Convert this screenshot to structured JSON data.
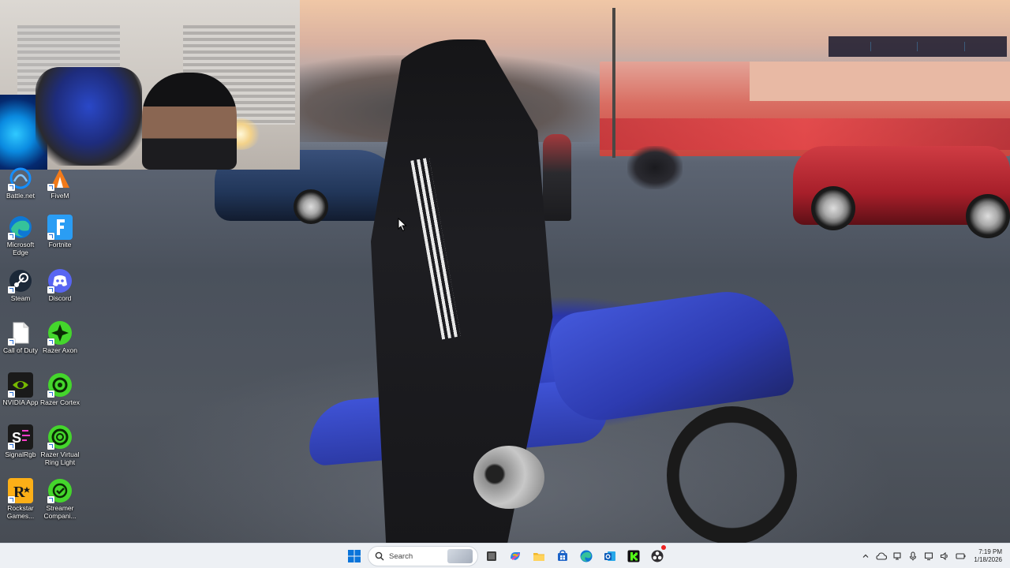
{
  "desktop": {
    "icons": [
      {
        "label": "Battle.net",
        "icon": "battlenet-icon",
        "color": "#148eff"
      },
      {
        "label": "FiveM",
        "icon": "fivem-icon",
        "color": "#f27a1a"
      },
      {
        "label": "Microsoft Edge",
        "icon": "edge-icon",
        "color": "#1fa37a"
      },
      {
        "label": "Fortnite",
        "icon": "fortnite-icon",
        "color": "#2a9df4"
      },
      {
        "label": "Steam",
        "icon": "steam-icon",
        "color": "#1b2838"
      },
      {
        "label": "Discord",
        "icon": "discord-icon",
        "color": "#5865f2"
      },
      {
        "label": "Call of Duty",
        "icon": "file-icon",
        "color": "#ffffff"
      },
      {
        "label": "Razer Axon",
        "icon": "razer-axon-icon",
        "color": "#44d62c"
      },
      {
        "label": "NVIDIA App",
        "icon": "nvidia-icon",
        "color": "#76b900"
      },
      {
        "label": "Razer Cortex",
        "icon": "razer-cortex-icon",
        "color": "#44d62c"
      },
      {
        "label": "SignalRgb",
        "icon": "signalrgb-icon",
        "color": "#1a1a1a"
      },
      {
        "label": "Razer Virtual Ring Light",
        "icon": "razer-ring-light-icon",
        "color": "#44d62c"
      },
      {
        "label": "Rockstar Games...",
        "icon": "rockstar-icon",
        "color": "#fcaf17"
      },
      {
        "label": "Streamer Compani...",
        "icon": "streamer-companion-icon",
        "color": "#44d62c"
      }
    ]
  },
  "taskbar": {
    "search_placeholder": "Search",
    "pinned": [
      "file-explorer",
      "task-view",
      "copilot",
      "folder",
      "store",
      "edge",
      "outlook",
      "kick",
      "obs"
    ],
    "clock_time": "7:19 PM",
    "clock_date": "1/18/2026"
  },
  "colors": {
    "taskbar_bg": "#edf0f4",
    "windows_blue": "#0a74da",
    "kick_green": "#53fc18"
  }
}
